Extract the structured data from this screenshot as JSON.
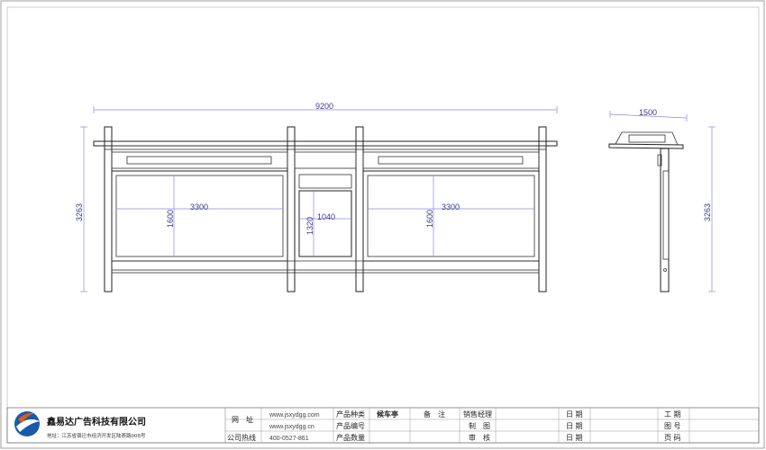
{
  "front_view": {
    "total_width": "9200",
    "height": "3263",
    "left_panel": {
      "width": "3300",
      "height": "1600"
    },
    "center_panel": {
      "width": "1040",
      "height": "1320"
    },
    "right_panel": {
      "width": "3300",
      "height": "1600"
    }
  },
  "side_view": {
    "width": "1500",
    "height": "3263"
  },
  "title_block": {
    "company_name": "鑫易达广告科技有限公司",
    "address": "地址：江苏省宿迁市经济开发区陆荟路008号",
    "website_label": "网　址",
    "website_1": "www.jsxydgg.com",
    "website_2": "www.jsxydgg.cn",
    "hotline_label": "公司热线",
    "hotline": "400-0527-861",
    "product_type_label": "产品种类",
    "product_type_value": "候车亭",
    "product_code_label": "产品编号",
    "product_qty_label": "产品数量",
    "remarks_label": "备　注",
    "sales_manager_label": "销售经理",
    "drawing_label": "制　图",
    "review_label": "审　核",
    "date_label_1": "日 期",
    "date_label_2": "日 期",
    "date_label_3": "日 期",
    "project_no_label": "工 期",
    "drawing_no_label": "图 号",
    "page_label": "页 码"
  }
}
